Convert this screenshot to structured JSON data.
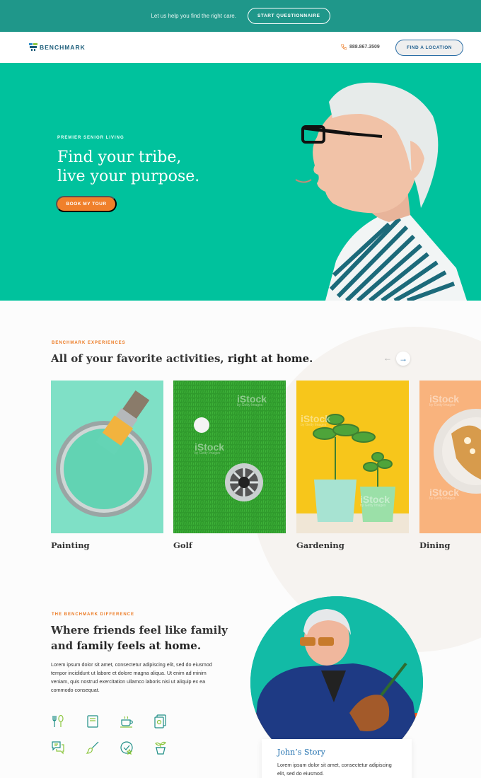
{
  "topbar": {
    "text": "Let us help you find the right care.",
    "button": "START QUESTIONNAIRE"
  },
  "header": {
    "logo": "BENCHMARK",
    "phone": "888.867.3509",
    "location_button": "FIND A LOCATION"
  },
  "hero": {
    "eyebrow": "PREMIER SENIOR LIVING",
    "title_line1": "Find your tribe,",
    "title_line2": "live your purpose.",
    "button": "BOOK MY TOUR"
  },
  "experiences": {
    "eyebrow": "BENCHMARK EXPERIENCES",
    "title_plain": "All of your favorite activities, ",
    "title_bold": "right at home.",
    "cards": [
      {
        "label": "Painting"
      },
      {
        "label": "Golf"
      },
      {
        "label": "Gardening"
      },
      {
        "label": "Dining"
      }
    ],
    "watermark": "iStock",
    "watermark_sub": "by Getty Images"
  },
  "difference": {
    "eyebrow": "THE BENCHMARK DIFFERENCE",
    "title_line1": "Where friends feel like family",
    "title_line2_plain": "and ",
    "title_line2_bold": "family feels at home.",
    "body": "Lorem ipsum dolor sit amet, consectetur adipiscing elit, sed do eiusmod tempor incididunt ut labore et dolore magna aliqua. Ut enim ad minim veniam, quis nostrud exercitation ullamco laboris nisi ut aliquip ex ea commodo consequat.",
    "icons": [
      "dining-icon",
      "book-icon",
      "coffee-icon",
      "puzzle-icon",
      "chat-icon",
      "paintbrush-icon",
      "badge-icon",
      "plant-icon"
    ]
  },
  "story": {
    "title": "John’s Story",
    "body": "Lorem ipsum dolor sit amet, consectetur adipiscing elit, sed do eiusmod."
  },
  "colors": {
    "topbar": "#1f978a",
    "hero": "#00c29d",
    "accent_orange": "#f0802b",
    "accent_blue": "#1f6fae"
  }
}
